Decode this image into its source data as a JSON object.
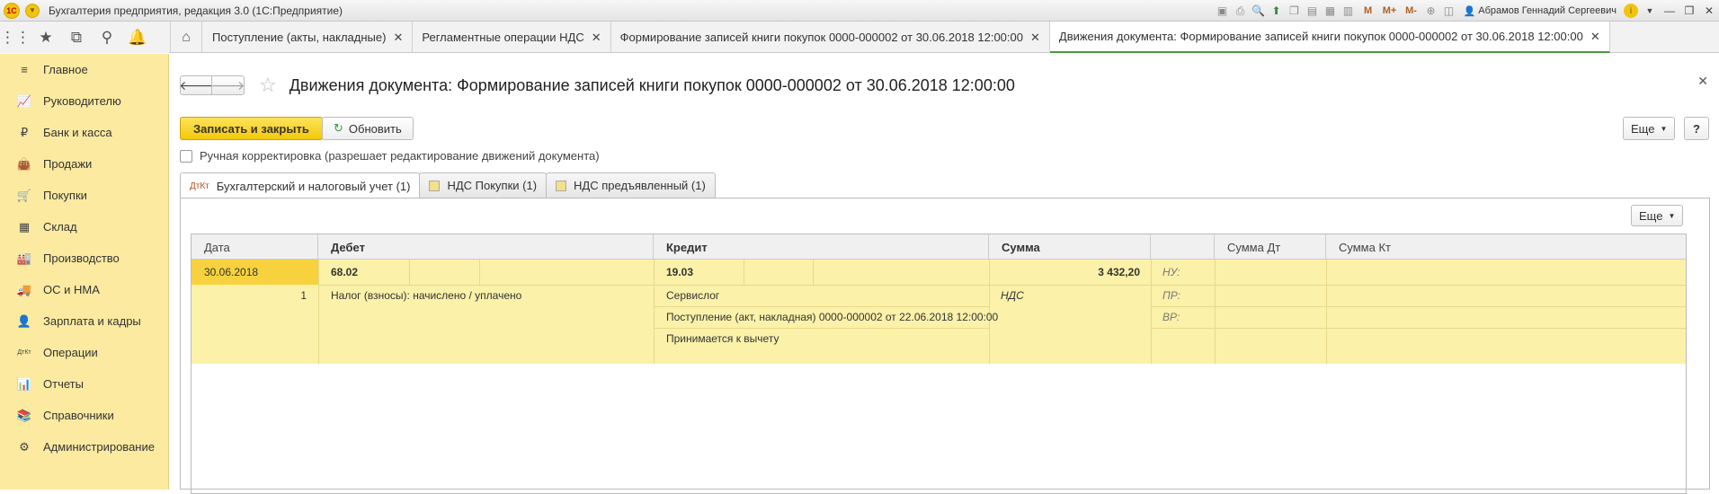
{
  "window": {
    "title": "Бухгалтерия предприятия, редакция 3.0  (1С:Предприятие)",
    "logo_text": "1С",
    "user": "Абрамов Геннадий Сергеевич",
    "memory_buttons": [
      "M",
      "M+",
      "M-"
    ]
  },
  "tabs": [
    {
      "label": "Поступление (акты, накладные)"
    },
    {
      "label": "Регламентные операции НДС"
    },
    {
      "label": "Формирование записей книги покупок 0000-000002 от 30.06.2018 12:00:00"
    },
    {
      "label": "Движения документа: Формирование записей книги покупок 0000-000002 от 30.06.2018 12:00:00"
    }
  ],
  "sidebar": {
    "items": [
      {
        "label": "Главное",
        "icon": "≡"
      },
      {
        "label": "Руководителю",
        "icon": "📈"
      },
      {
        "label": "Банк и касса",
        "icon": "₽"
      },
      {
        "label": "Продажи",
        "icon": "👜"
      },
      {
        "label": "Покупки",
        "icon": "🛒"
      },
      {
        "label": "Склад",
        "icon": "▦"
      },
      {
        "label": "Производство",
        "icon": "🏭"
      },
      {
        "label": "ОС и НМА",
        "icon": "🚚"
      },
      {
        "label": "Зарплата и кадры",
        "icon": "👤"
      },
      {
        "label": "Операции",
        "icon": "ДтКт"
      },
      {
        "label": "Отчеты",
        "icon": "📊"
      },
      {
        "label": "Справочники",
        "icon": "📚"
      },
      {
        "label": "Администрирование",
        "icon": "⚙"
      }
    ]
  },
  "page": {
    "title": "Движения документа: Формирование записей книги покупок 0000-000002 от 30.06.2018 12:00:00",
    "save_close": "Записать и закрыть",
    "refresh": "Обновить",
    "more": "Еще",
    "help": "?",
    "manual_checkbox": "Ручная корректировка (разрешает редактирование движений документа)"
  },
  "form_tabs": [
    {
      "label": "Бухгалтерский и налоговый учет (1)",
      "icon": "ДтКт"
    },
    {
      "label": "НДС Покупки (1)"
    },
    {
      "label": "НДС предъявленный (1)"
    }
  ],
  "panel": {
    "more": "Еще"
  },
  "grid": {
    "headers": {
      "date": "Дата",
      "debit": "Дебет",
      "credit": "Кредит",
      "sum": "Сумма",
      "sum_dt": "Сумма Дт",
      "sum_kt": "Сумма Кт"
    },
    "row": {
      "date": "30.06.2018",
      "number": "1",
      "debit_account": "68.02",
      "debit_subconto1": "Налог (взносы): начислено / уплачено",
      "credit_account": "19.03",
      "credit_subconto1": "Сервислог",
      "credit_subconto2": "Поступление (акт, накладная) 0000-000002 от 22.06.2018 12:00:00",
      "credit_subconto3": "Принимается к вычету",
      "sum": "3 432,20",
      "sum_label": "НДС",
      "nu": "НУ:",
      "pr": "ПР:",
      "vr": "ВР:"
    }
  }
}
